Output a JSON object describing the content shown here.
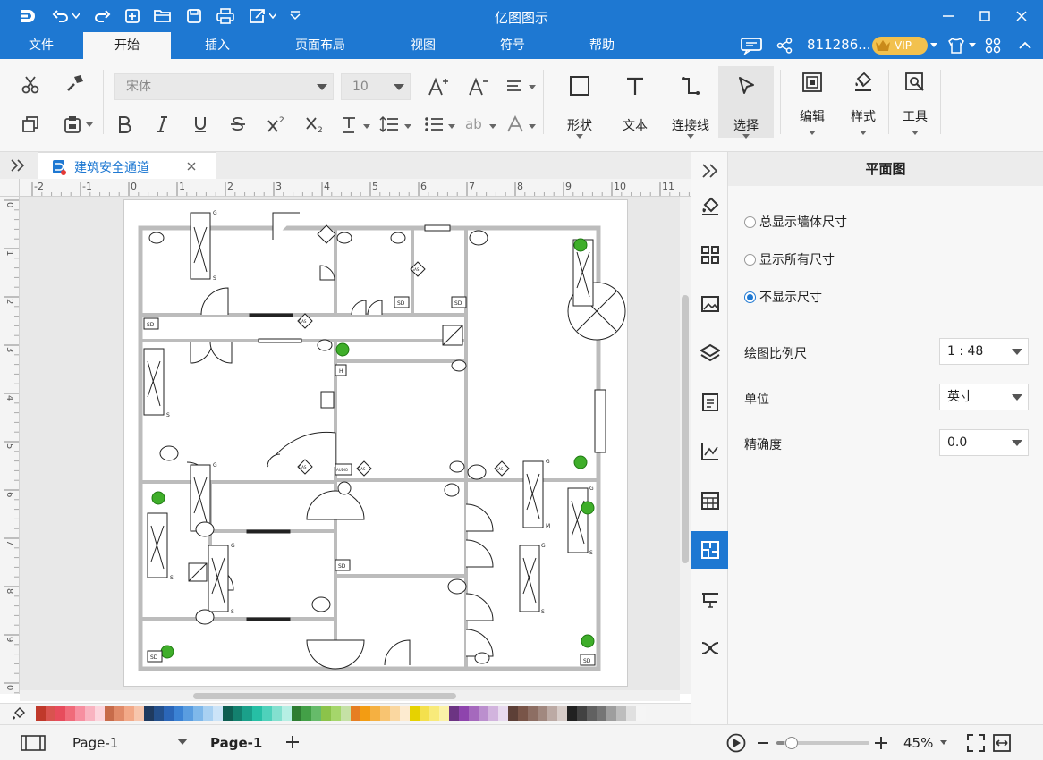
{
  "title_bar": {
    "title": "亿图图示"
  },
  "menu": {
    "items": [
      "文件",
      "开始",
      "插入",
      "页面布局",
      "视图",
      "符号",
      "帮助"
    ],
    "active": "开始",
    "user_id": "811286...",
    "vip_label": "VIP"
  },
  "ribbon": {
    "font_name": "宋体",
    "font_size": "10",
    "shape_label": "形状",
    "text_label": "文本",
    "connector_label": "连接线",
    "select_label": "选择",
    "edit_label": "编辑",
    "style_label": "样式",
    "tools_label": "工具"
  },
  "document_tab": {
    "name": "建筑安全通道"
  },
  "rulers": {
    "horizontal": [
      "-2",
      "-1",
      "0",
      "1",
      "2",
      "3",
      "4",
      "5",
      "6",
      "7",
      "8",
      "9",
      "10",
      "11"
    ],
    "vertical": [
      "0",
      "1",
      "2",
      "3",
      "4",
      "5",
      "6",
      "7",
      "8",
      "9",
      "0"
    ]
  },
  "floorplan": {
    "labels": {
      "sd": "SD",
      "gas": "GAS",
      "audio": "AUDIO",
      "h": "H",
      "g": "G",
      "s": "S",
      "m": "M"
    }
  },
  "right_panel": {
    "title": "平面图",
    "options": [
      {
        "label": "总显示墙体尺寸",
        "selected": false
      },
      {
        "label": "显示所有尺寸",
        "selected": false
      },
      {
        "label": "不显示尺寸",
        "selected": true
      }
    ],
    "scale_label": "绘图比例尺",
    "scale_value": "1 : 48",
    "unit_label": "单位",
    "unit_value": "英寸",
    "precision_label": "精确度",
    "precision_value": "0.0"
  },
  "status_bar": {
    "page_selector": "Page-1",
    "page_tab": "Page-1",
    "zoom": "45%",
    "zoom_level": 0.45
  },
  "palette_colors": [
    "#c0392b",
    "#d9534f",
    "#e74c5c",
    "#f06b7a",
    "#f78fa0",
    "#f9b3c0",
    "#fcd5dd",
    "#c76b4a",
    "#e08a68",
    "#f2a988",
    "#f7c6ad",
    "#1f3a5f",
    "#24508c",
    "#2b66b8",
    "#3b82d4",
    "#5a9de0",
    "#7fb8ea",
    "#a9d1f2",
    "#cce4f8",
    "#0e5e52",
    "#13806e",
    "#1aa08a",
    "#26bfa5",
    "#4fd1bb",
    "#83e0cf",
    "#b6efe4",
    "#2e7d32",
    "#43a047",
    "#66bb6a",
    "#8bc34a",
    "#a5d66b",
    "#c5e1a5",
    "#e67e22",
    "#f39c12",
    "#f5b041",
    "#f8c471",
    "#fad7a0",
    "#fdebd0",
    "#e6d200",
    "#f4e04d",
    "#f8ea7a",
    "#fbf2a8",
    "#6c3483",
    "#8e44ad",
    "#a569bd",
    "#bb8fce",
    "#d2b4de",
    "#e8daef",
    "#5d4037",
    "#795548",
    "#8d6e63",
    "#a1887f",
    "#bcaaa4",
    "#d7ccc8",
    "#212121",
    "#424242",
    "#616161",
    "#757575",
    "#9e9e9e",
    "#bdbdbd",
    "#e0e0e0",
    "#f5f5f5"
  ]
}
